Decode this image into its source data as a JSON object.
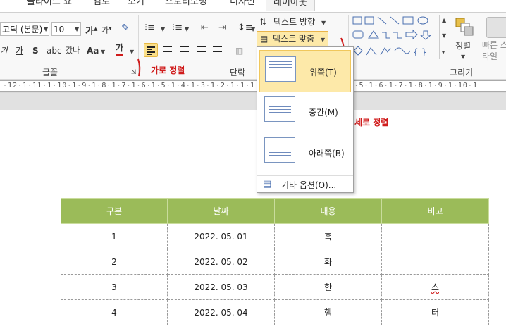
{
  "tabs": [
    "슬라이드 쇼",
    "검토",
    "보기",
    "스토리보딩",
    "디자인",
    "레이아웃"
  ],
  "font": {
    "name": "고딕 (본문)",
    "size": "10",
    "group_label": "글꼴"
  },
  "paragraph": {
    "group_label": "단락"
  },
  "text_direction": {
    "label": "텍스트 방향"
  },
  "text_align": {
    "label": "텍스트 맞춤",
    "options": [
      {
        "label": "위쪽(T)",
        "icon": "align-top-icon"
      },
      {
        "label": "중간(M)",
        "icon": "align-middle-icon"
      },
      {
        "label": "아래쪽(B)",
        "icon": "align-bottom-icon"
      }
    ],
    "more_label": "기타 옵션(O)..."
  },
  "arrange": {
    "label": "정렬"
  },
  "quick_styles": {
    "label": "빠른 스타일"
  },
  "drawing": {
    "group_label": "그리기"
  },
  "annotations": {
    "horizontal": "가로 정렬",
    "vertical": "세로 정렬"
  },
  "ruler": {
    "text": "·12·1·11·1·10·1·9·1·8·1·7·1·6·1·5·1·4·1·3·1·2·1·1·1·0·1·1·1·2·1·3·1·4·1·5·1·6·1·7·1·8·1·9·1·10·1"
  },
  "table": {
    "headers": [
      "구분",
      "날짜",
      "내용",
      "비고"
    ],
    "rows": [
      [
        "1",
        "2022. 05. 01",
        "흑",
        ""
      ],
      [
        "2",
        "2022. 05. 02",
        "화",
        ""
      ],
      [
        "3",
        "2022. 05. 03",
        "한",
        "스"
      ],
      [
        "4",
        "2022. 05. 04",
        "햄",
        "터"
      ]
    ],
    "header_color": "#9bbb59"
  }
}
